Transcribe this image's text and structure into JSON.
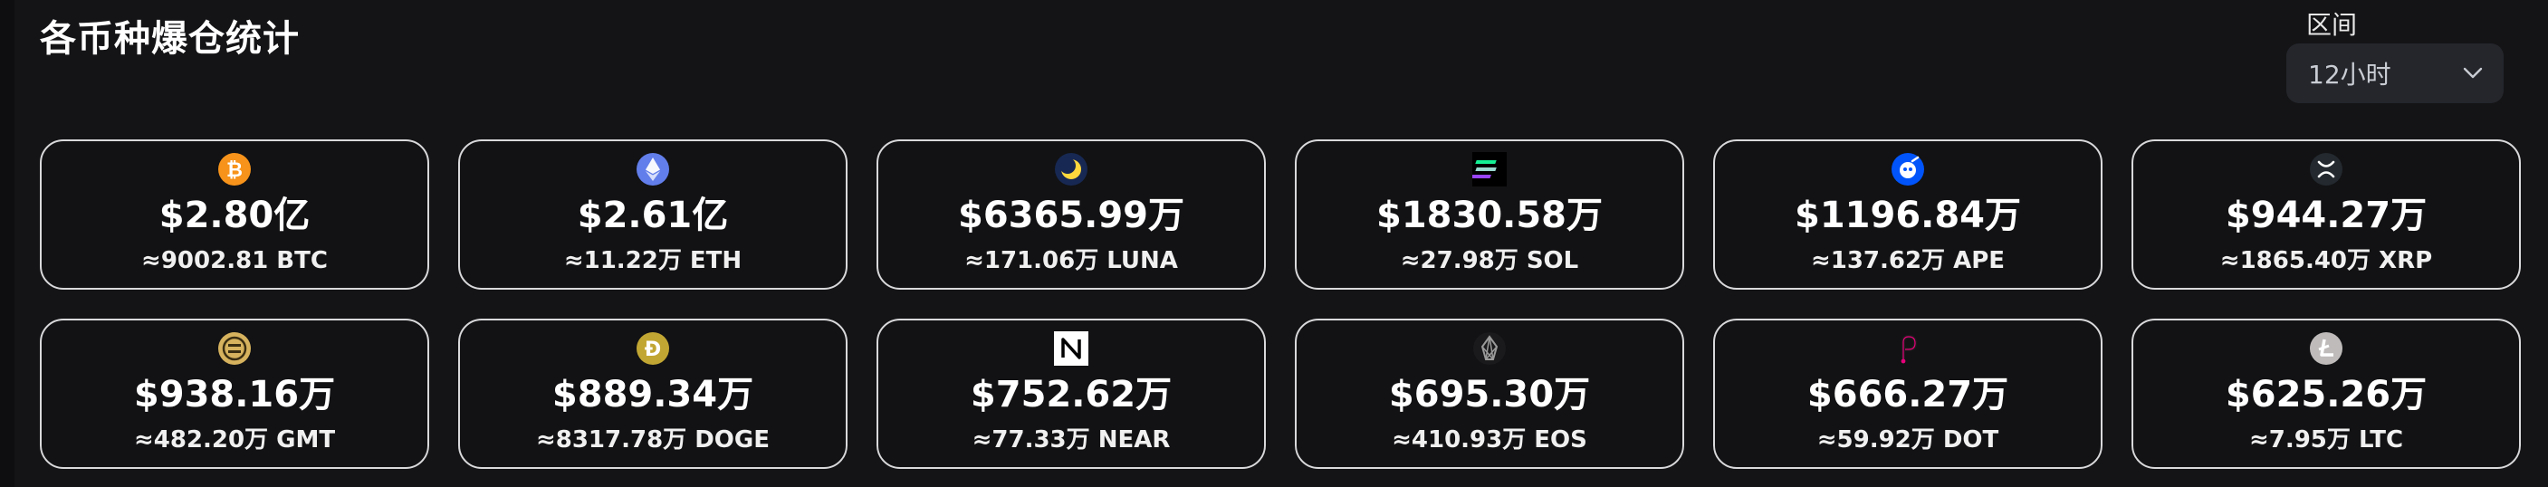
{
  "header": {
    "title": "各币种爆仓统计",
    "range_label": "区间",
    "range_value": "12小时"
  },
  "coins": [
    {
      "amount": "$2.80亿",
      "qty": "≈9002.81 BTC",
      "icon": "btc-icon",
      "color": "#f7931a"
    },
    {
      "amount": "$2.61亿",
      "qty": "≈11.22万 ETH",
      "icon": "eth-icon",
      "color": "#627eea"
    },
    {
      "amount": "$6365.99万",
      "qty": "≈171.06万 LUNA",
      "icon": "luna-icon",
      "color": "#172852"
    },
    {
      "amount": "$1830.58万",
      "qty": "≈27.98万 SOL",
      "icon": "sol-icon",
      "color": "#000000"
    },
    {
      "amount": "$1196.84万",
      "qty": "≈137.62万 APE",
      "icon": "ape-icon",
      "color": "#0054fa"
    },
    {
      "amount": "$944.27万",
      "qty": "≈1865.40万 XRP",
      "icon": "xrp-icon",
      "color": "#23292f"
    },
    {
      "amount": "$938.16万",
      "qty": "≈482.20万 GMT",
      "icon": "gmt-icon",
      "color": "#d6b25e"
    },
    {
      "amount": "$889.34万",
      "qty": "≈8317.78万 DOGE",
      "icon": "doge-icon",
      "color": "#c2a633"
    },
    {
      "amount": "$752.62万",
      "qty": "≈77.33万 NEAR",
      "icon": "near-icon",
      "color": "#ffffff"
    },
    {
      "amount": "$695.30万",
      "qty": "≈410.93万 EOS",
      "icon": "eos-icon",
      "color": "#000000"
    },
    {
      "amount": "$666.27万",
      "qty": "≈59.92万 DOT",
      "icon": "dot-icon",
      "color": "#e6007a"
    },
    {
      "amount": "$625.26万",
      "qty": "≈7.95万 LTC",
      "icon": "ltc-icon",
      "color": "#bfbbbb"
    }
  ]
}
